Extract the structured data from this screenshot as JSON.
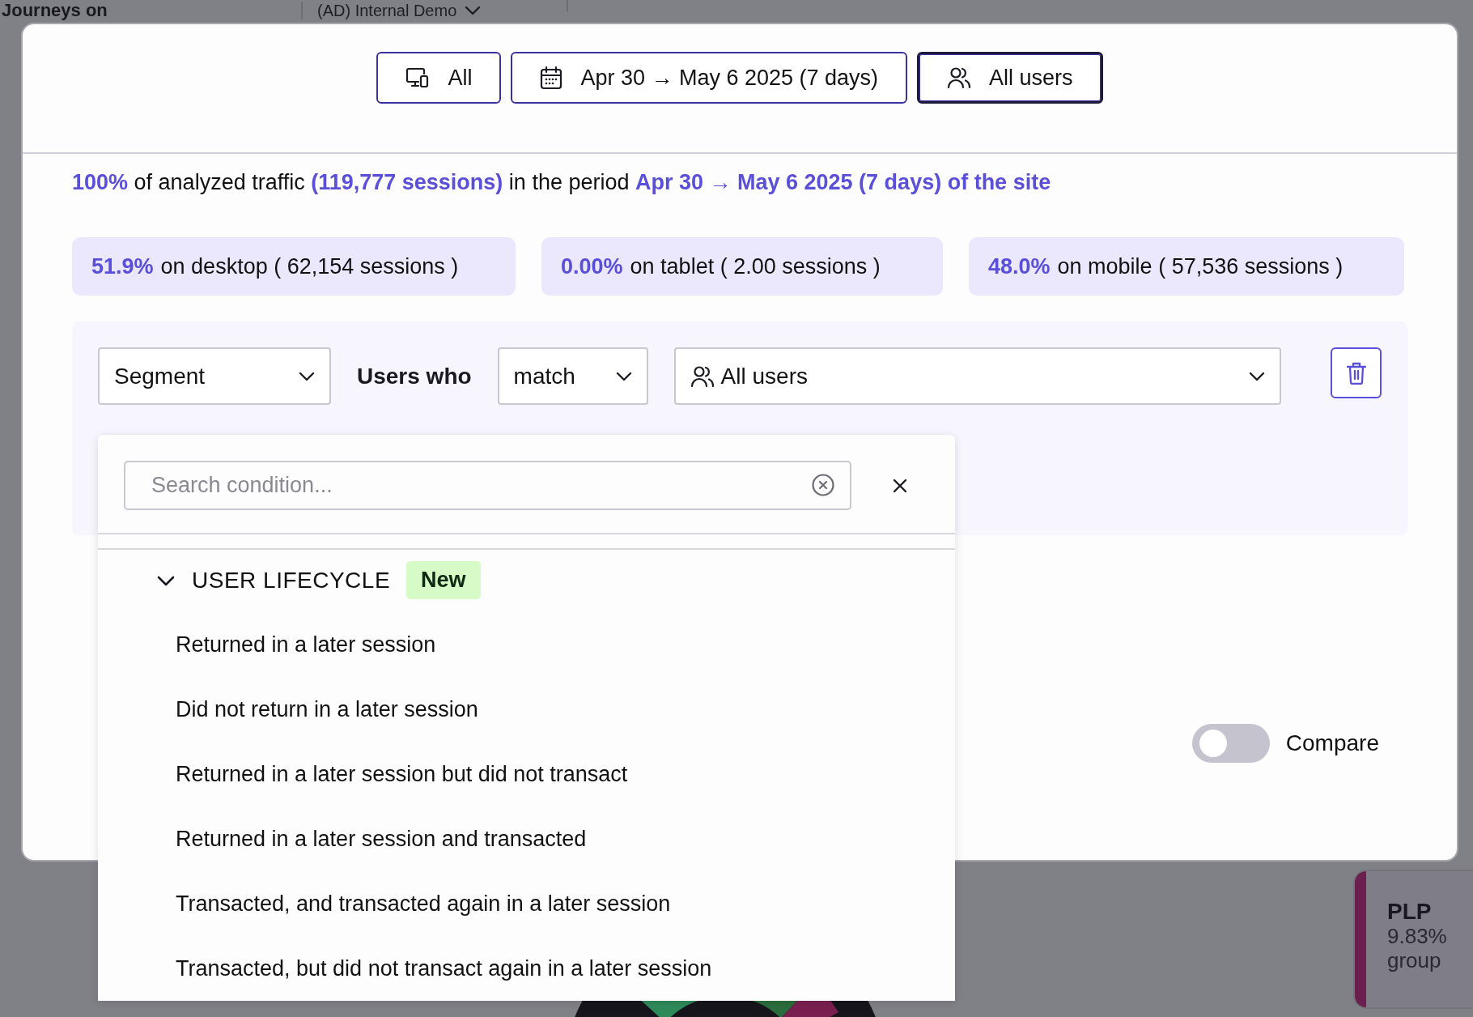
{
  "background": {
    "title": "Journeys on",
    "workspace": "(AD) Internal Demo",
    "card": {
      "title": "PLP",
      "value": "9.83%",
      "caption": "group",
      "color": "#6b1f4e"
    }
  },
  "top_buttons": [
    {
      "kind": "device",
      "label": "All",
      "selected": false
    },
    {
      "kind": "date",
      "label": "Apr 30 → May 6 2025 (7 days)",
      "selected": false
    },
    {
      "kind": "users",
      "label": "All users",
      "selected": true
    }
  ],
  "summary": [
    {
      "text": "100%",
      "highlight": true
    },
    {
      "text": " of analyzed traffic ",
      "highlight": false
    },
    {
      "text": "(119,777 sessions)",
      "highlight": true
    },
    {
      "text": " in the period ",
      "highlight": false
    },
    {
      "text": "Apr 30 → May 6 2025 (7 days) of the site",
      "highlight": true
    }
  ],
  "device_cards": [
    {
      "percent": "51.9%",
      "text": "on desktop ( 62,154 sessions )"
    },
    {
      "percent": "0.00%",
      "text": "on tablet ( 2.00 sessions )"
    },
    {
      "percent": "48.0%",
      "text": "on mobile ( 57,536 sessions )"
    }
  ],
  "filter": {
    "segment": "Segment",
    "connector": "Users who",
    "operator": "match",
    "audience": "All users"
  },
  "dropdown": {
    "placeholder": "Search condition...",
    "groups": [
      {
        "title": "USER LIFECYCLE",
        "badge": "New",
        "expanded": true,
        "items": [
          "Returned in a later session",
          "Did not return in a later session",
          "Returned in a later session but did not transact",
          "Returned in a later session and transacted",
          "Transacted, and transacted again in a later session",
          "Transacted, but did not transact again in a later session"
        ]
      }
    ]
  },
  "compare": {
    "label": "Compare",
    "on": false
  }
}
